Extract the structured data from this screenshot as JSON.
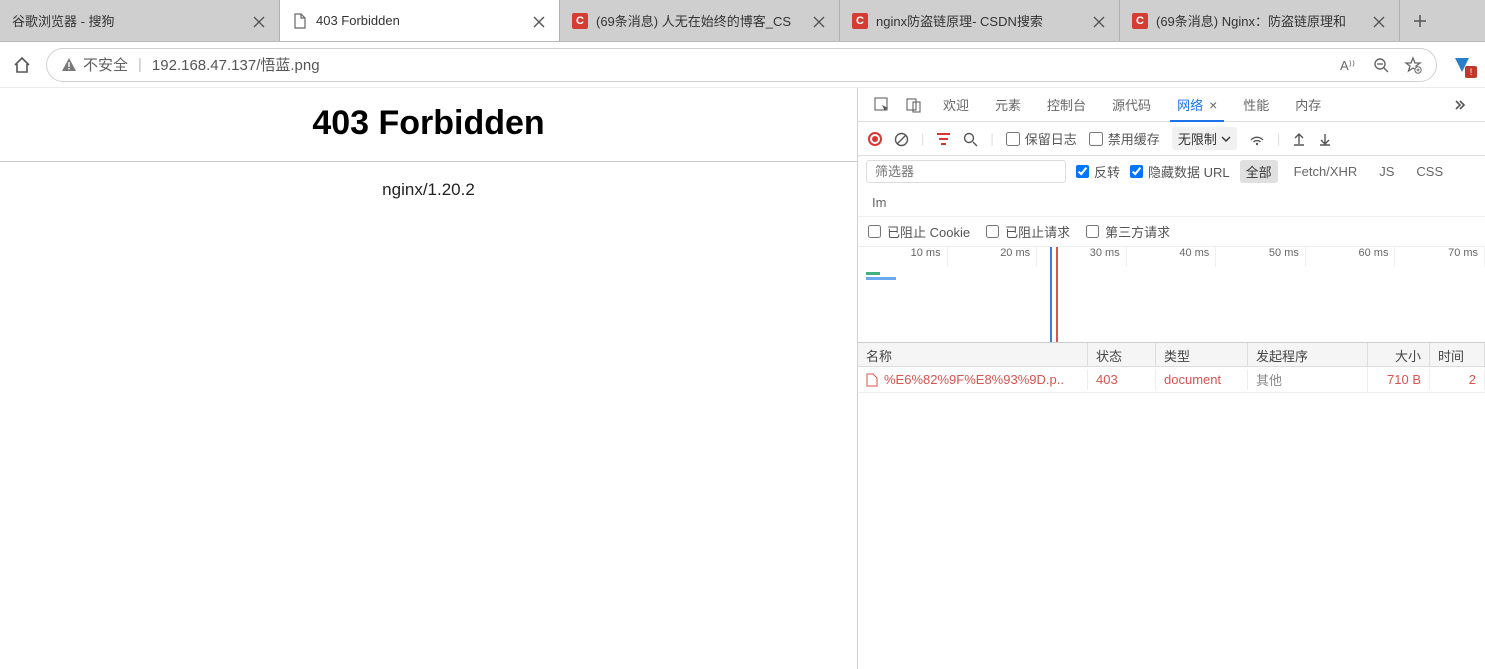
{
  "tabs": [
    {
      "title": "谷歌浏览器 - 搜狗",
      "type": "inactive"
    },
    {
      "title": "403 Forbidden",
      "type": "active-doc"
    },
    {
      "title": "(69条消息) 人无在始终的博客_CS",
      "type": "csdn"
    },
    {
      "title": "nginx防盗链原理- CSDN搜索",
      "type": "csdn"
    },
    {
      "title": "(69条消息) Nginx：防盗链原理和",
      "type": "csdn"
    }
  ],
  "address": {
    "insecure_label": "不安全",
    "url": "192.168.47.137/悟蓝.png"
  },
  "page": {
    "heading": "403 Forbidden",
    "server": "nginx/1.20.2"
  },
  "devtools": {
    "tabs": {
      "welcome": "欢迎",
      "elements": "元素",
      "console": "控制台",
      "sources": "源代码",
      "network": "网络",
      "performance": "性能",
      "memory": "内存"
    },
    "toolbar": {
      "preserve_log": "保留日志",
      "disable_cache": "禁用缓存",
      "throttle": "无限制"
    },
    "filter": {
      "placeholder": "筛选器",
      "invert": "反转",
      "hide_data_urls": "隐藏数据 URL",
      "type_all": "全部",
      "type_fetch": "Fetch/XHR",
      "type_js": "JS",
      "type_css": "CSS",
      "type_im": "Im"
    },
    "filter2": {
      "blocked_cookies": "已阻止 Cookie",
      "blocked_requests": "已阻止请求",
      "third_party": "第三方请求"
    },
    "timeline_ticks": [
      "10 ms",
      "20 ms",
      "30 ms",
      "40 ms",
      "50 ms",
      "60 ms",
      "70 ms"
    ],
    "headers": {
      "name": "名称",
      "status": "状态",
      "type": "类型",
      "initiator": "发起程序",
      "size": "大小",
      "time": "时间"
    },
    "rows": [
      {
        "name": "%E6%82%9F%E8%93%9D.p..",
        "status": "403",
        "type": "document",
        "initiator": "其他",
        "size": "710 B",
        "time": "2"
      }
    ]
  }
}
